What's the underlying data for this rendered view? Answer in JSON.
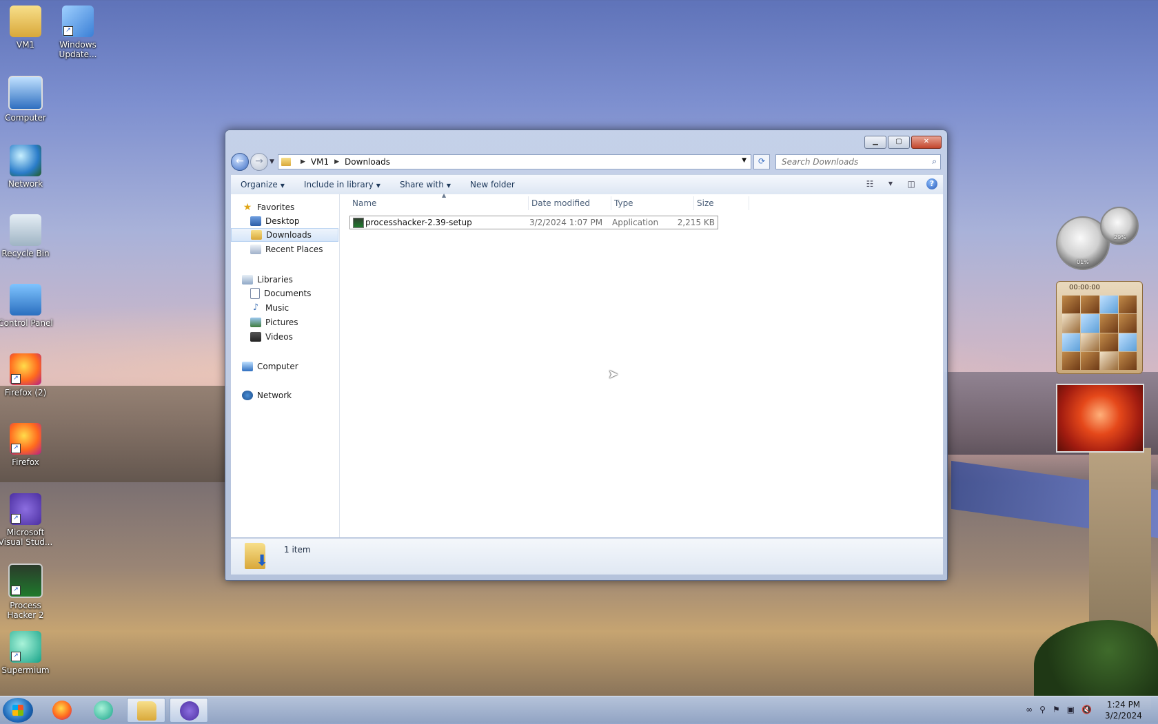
{
  "desktop": {
    "icons": [
      {
        "label": "VM1"
      },
      {
        "label": "Windows Update..."
      },
      {
        "label": "Computer"
      },
      {
        "label": "Network"
      },
      {
        "label": "Recycle Bin"
      },
      {
        "label": "Control Panel"
      },
      {
        "label": "Firefox (2)"
      },
      {
        "label": "Firefox"
      },
      {
        "label": "Microsoft Visual Stud..."
      },
      {
        "label": "Process Hacker 2"
      },
      {
        "label": "Supermium"
      }
    ]
  },
  "window": {
    "breadcrumb": [
      "VM1",
      "Downloads"
    ],
    "search_placeholder": "Search Downloads",
    "toolbar": {
      "organize": "Organize",
      "include_in_library": "Include in library",
      "share_with": "Share with",
      "new_folder": "New folder"
    },
    "nav": {
      "favorites": "Favorites",
      "desktop": "Desktop",
      "downloads": "Downloads",
      "recent_places": "Recent Places",
      "libraries": "Libraries",
      "documents": "Documents",
      "music": "Music",
      "pictures": "Pictures",
      "videos": "Videos",
      "computer": "Computer",
      "network": "Network"
    },
    "columns": {
      "name": "Name",
      "date_modified": "Date modified",
      "type": "Type",
      "size": "Size"
    },
    "files": [
      {
        "name": "processhacker-2.39-setup",
        "date_modified": "3/2/2024 1:07 PM",
        "type": "Application",
        "size": "2,215 KB"
      }
    ],
    "status": "1 item"
  },
  "gadgets": {
    "cpu_percent": "01%",
    "memory_percent": "29%",
    "puzzle_timer": "00:00:00"
  },
  "taskbar": {
    "time": "1:24 PM",
    "date": "3/2/2024"
  }
}
